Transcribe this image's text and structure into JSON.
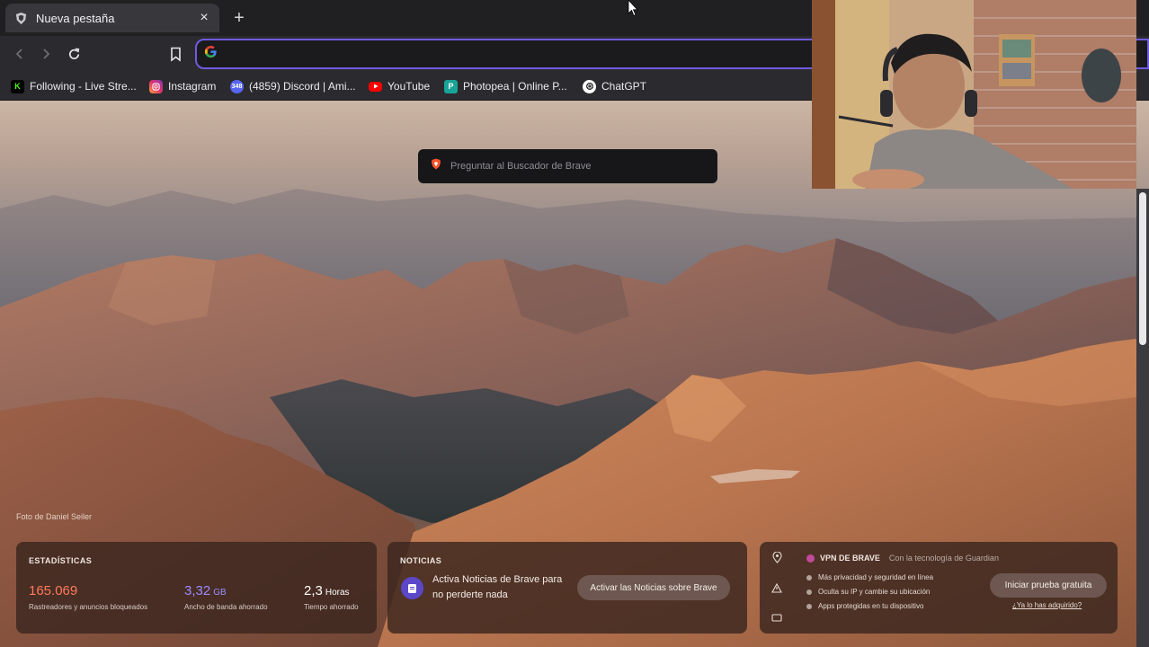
{
  "tab": {
    "title": "Nueva pestaña",
    "close_glyph": "×",
    "new_tab_glyph": "+"
  },
  "toolbar": {
    "back_icon": "chevron-left-icon",
    "forward_icon": "chevron-right-icon",
    "reload_icon": "reload-icon",
    "bookmark_icon": "bookmark-icon",
    "address_value": "",
    "address_icon": "google-icon"
  },
  "bookmarks": [
    {
      "label": "Following - Live Stre...",
      "icon": "kick-icon",
      "color": "#53fc18"
    },
    {
      "label": "Instagram",
      "icon": "instagram-icon",
      "color": "#e1306c"
    },
    {
      "label": "(4859) Discord | Ami...",
      "icon": "discord-icon",
      "color": "#5865f2"
    },
    {
      "label": "YouTube",
      "icon": "youtube-icon",
      "color": "#ff0000"
    },
    {
      "label": "Photopea | Online P...",
      "icon": "photopea-icon",
      "color": "#18a497"
    },
    {
      "label": "ChatGPT",
      "icon": "chatgpt-icon",
      "color": "#ffffff"
    }
  ],
  "search": {
    "placeholder": "Preguntar al Buscador de Brave"
  },
  "photo_credit": "Foto de Daniel Seiler",
  "stats": {
    "header": "ESTADÍSTICAS",
    "items": [
      {
        "value": "165.069",
        "unit": "",
        "caption": "Rastreadores y anuncios bloqueados",
        "color": "#ff7a5c"
      },
      {
        "value": "3,32",
        "unit": "GB",
        "caption": "Ancho de banda ahorrado",
        "color": "#9b8cff"
      },
      {
        "value": "2,3",
        "unit": "Horas",
        "caption": "Tiempo ahorrado",
        "color": "#ffffff"
      }
    ]
  },
  "news": {
    "header": "NOTICIAS",
    "text": "Activa Noticias de Brave para no perderte nada",
    "button": "Activar las Noticias sobre Brave"
  },
  "vpn": {
    "title": "VPN DE BRAVE",
    "tech": "Con la tecnología de  Guardian",
    "features": [
      "Más privacidad y seguridad en línea",
      "Oculta su IP y cambie su ubicación",
      "Apps protegidas en tu dispositivo"
    ],
    "cta": "Iniciar prueba gratuita",
    "link": "¿Ya lo has adquirido?"
  },
  "colors": {
    "accent_focus": "#6f5be0",
    "brave_orange": "#fb542b"
  }
}
